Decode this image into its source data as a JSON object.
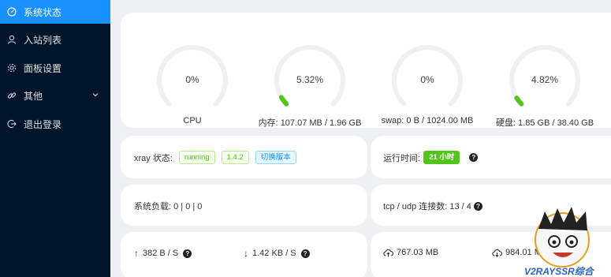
{
  "sidebar": {
    "items": [
      {
        "label": "系统状态",
        "icon": "dashboard-icon",
        "active": true
      },
      {
        "label": "入站列表",
        "icon": "user-icon"
      },
      {
        "label": "面板设置",
        "icon": "gear-icon"
      },
      {
        "label": "其他",
        "icon": "link-icon",
        "has_submenu": true
      },
      {
        "label": "退出登录",
        "icon": "logout-icon"
      }
    ]
  },
  "gauges": [
    {
      "name": "cpu",
      "percent_text": "0%",
      "value": 0,
      "label": "CPU"
    },
    {
      "name": "memory",
      "percent_text": "5.32%",
      "value": 5.32,
      "label": "内存: 107.07 MB / 1.96 GB"
    },
    {
      "name": "swap",
      "percent_text": "0%",
      "value": 0,
      "label": "swap: 0 B / 1024.00 MB"
    },
    {
      "name": "disk",
      "percent_text": "4.82%",
      "value": 4.82,
      "label": "硬盘: 1.85 GB / 38.40 GB"
    }
  ],
  "xray": {
    "label": "xray 状态:",
    "status": "running",
    "version": "1.4.2",
    "switch_label": "切换版本"
  },
  "uptime": {
    "label": "运行时间:",
    "value": "21 小时"
  },
  "load": {
    "text": "系统负载: 0 | 0 | 0"
  },
  "connections": {
    "text": "tcp / udp 连接数: 13 / 4"
  },
  "network": {
    "upload_speed": "382 B / S",
    "download_speed": "1.42 KB / S",
    "total_upload": "767.03 MB",
    "total_download": "984.01 MB"
  },
  "colors": {
    "sidebar_bg": "#001529",
    "active": "#1890ff",
    "gauge_fill": "#52c41a",
    "gauge_track": "#f0f0f0"
  },
  "watermark": {
    "text": "V2RAYSSR综合"
  }
}
